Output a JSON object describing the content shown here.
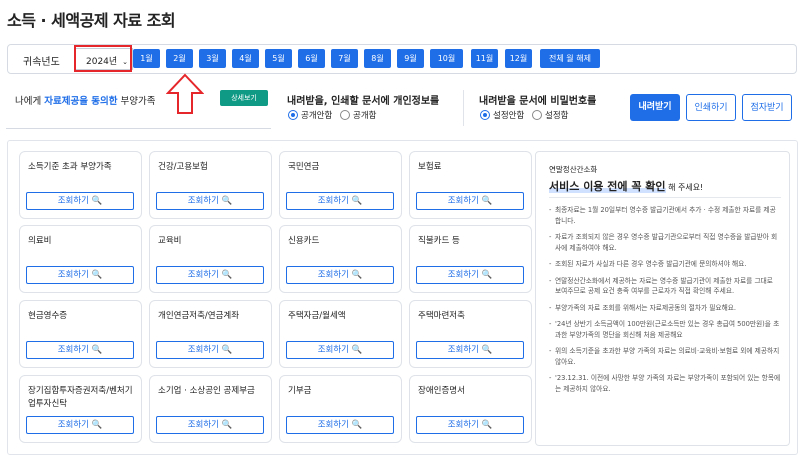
{
  "title": "소득 · 세액공제 자료 조회",
  "year_row": {
    "label": "귀속년도",
    "selected_year": "2024년",
    "months": [
      "1월",
      "2월",
      "3월",
      "4월",
      "5월",
      "6월",
      "7월",
      "8월",
      "9월",
      "10월",
      "11월",
      "12월"
    ],
    "clear_all": "전체 월 해제"
  },
  "me": {
    "prefix": "나에게 ",
    "highlight": "자료제공을 동의한",
    "suffix": " 부양가족",
    "detail_button": "상세보기"
  },
  "privacy": {
    "title": "내려받을, 인쇄할 문서에 개인정보를",
    "opt1": "공개안함",
    "opt2": "공개함"
  },
  "password": {
    "title": "내려받을 문서에 비밀번호를",
    "opt1": "설정안함",
    "opt2": "설정함"
  },
  "actions": {
    "download": "내려받기",
    "print": "인쇄하기",
    "view": "점자받기"
  },
  "cards": [
    {
      "label": "소득기준 초과 부양가족",
      "button": "조회하기 🔍"
    },
    {
      "label": "건강/고용보험",
      "button": "조회하기 🔍"
    },
    {
      "label": "국민연금",
      "button": "조회하기 🔍"
    },
    {
      "label": "보험료",
      "button": "조회하기 🔍"
    },
    {
      "label": "의료비",
      "button": "조회하기 🔍"
    },
    {
      "label": "교육비",
      "button": "조회하기 🔍"
    },
    {
      "label": "신용카드",
      "button": "조회하기 🔍"
    },
    {
      "label": "직불카드 등",
      "button": "조회하기 🔍"
    },
    {
      "label": "현금영수증",
      "button": "조회하기 🔍"
    },
    {
      "label": "개인연금저축/연금계좌",
      "button": "조회하기 🔍"
    },
    {
      "label": "주택자금/월세액",
      "button": "조회하기 🔍"
    },
    {
      "label": "주택마련저축",
      "button": "조회하기 🔍"
    },
    {
      "label": "장기집합투자증권저축/벤처기업투자신탁",
      "button": "조회하기 🔍"
    },
    {
      "label": "소기업 · 소상공인 공제부금",
      "button": "조회하기 🔍"
    },
    {
      "label": "기부금",
      "button": "조회하기 🔍"
    },
    {
      "label": "장애인증명서",
      "button": "조회하기 🔍"
    }
  ],
  "side": {
    "sub": "연말정산간소화",
    "head_bold": "서비스 이용 전에 꼭 확인",
    "head_tail": " 해 주세요!",
    "items": [
      "최종자료는 1월 20일부터 영수증 발급기관에서 추가 · 수정 제출한 자료를 제공합니다.",
      "자료가 조회되지 않은 경우 영수증 발급기관으로부터 직접 영수증을 발급받아 회사에 제출하여야 해요.",
      "조회된 자료가 사실과 다른 경우 영수증 발급기관에 문의하셔야 해요.",
      "연말정산간소화에서 제공하는 자료는 영수증 발급기관이 제출한 자료를 그대로 보여주므로 공제 요건 충족 여부를 근로자가 직접 확인해 주세요.",
      "부양가족의 자료 조회를 위해서는 자료제공동의 절차가 필요해요.",
      "'24년 상반기 소득금액이 100만원(근로소득만 있는 경우 총급여 500만원)을 초과한 부양가족의 명단을 회신해 처음 제공해요",
      "위의 소득기준을 초과한 부양 가족의 자료는 의료비·교육비·보험료 외에 제공하지 않아요.",
      "'23.12.31. 이전에 사망한 부양 가족의 자료는 부양가족이 포함되어 있는 항목에는 제공하지 않아요."
    ]
  },
  "colors": {
    "accent": "#1f6ee8",
    "teal": "#0f9a85",
    "highlight_red": "#e5272b"
  }
}
